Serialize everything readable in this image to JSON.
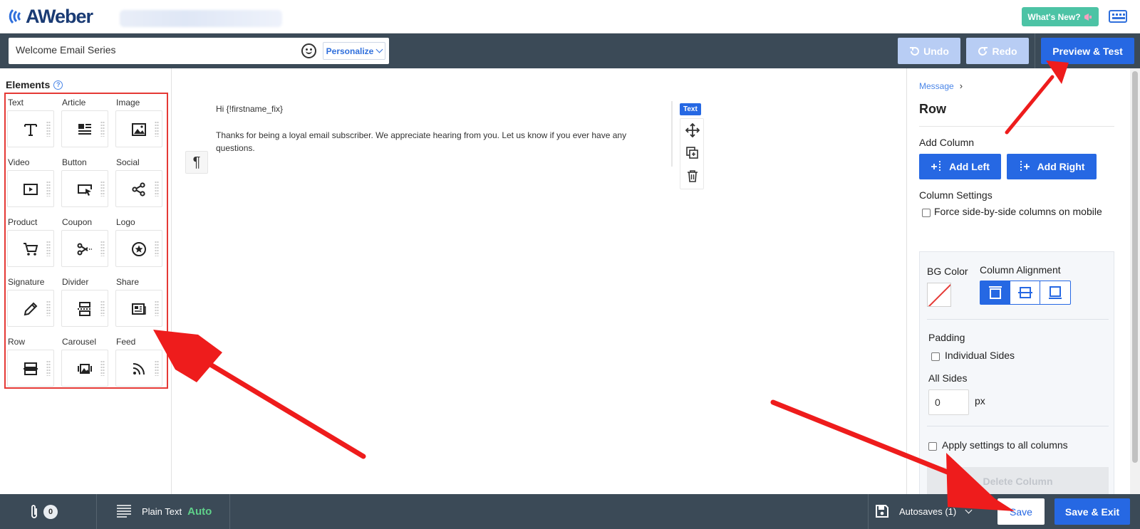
{
  "brand": {
    "name": "AWeber"
  },
  "header": {
    "whats_new_label": "What's New?",
    "whats_new_icon": "megaphone-icon"
  },
  "toolbar": {
    "subject_value": "Welcome Email Series",
    "personalize_label": "Personalize",
    "undo_label": "Undo",
    "redo_label": "Redo",
    "preview_label": "Preview & Test"
  },
  "elements_panel": {
    "title": "Elements",
    "items": [
      {
        "label": "Text",
        "icon": "text-icon"
      },
      {
        "label": "Article",
        "icon": "article-icon"
      },
      {
        "label": "Image",
        "icon": "image-icon"
      },
      {
        "label": "Video",
        "icon": "video-icon"
      },
      {
        "label": "Button",
        "icon": "button-icon"
      },
      {
        "label": "Social",
        "icon": "share-nodes-icon"
      },
      {
        "label": "Product",
        "icon": "cart-icon"
      },
      {
        "label": "Coupon",
        "icon": "scissors-icon"
      },
      {
        "label": "Logo",
        "icon": "star-badge-icon"
      },
      {
        "label": "Signature",
        "icon": "pen-icon"
      },
      {
        "label": "Divider",
        "icon": "divider-icon"
      },
      {
        "label": "Share",
        "icon": "newspaper-icon"
      },
      {
        "label": "Row",
        "icon": "row-icon"
      },
      {
        "label": "Carousel",
        "icon": "carousel-icon"
      },
      {
        "label": "Feed",
        "icon": "rss-icon"
      }
    ]
  },
  "canvas": {
    "greeting": "Hi {!firstname_fix}",
    "body": "Thanks for being a loyal email subscriber. We appreciate hearing from you. Let us know if you ever have any questions.",
    "block_tag": "Text",
    "paragraph_symbol": "¶"
  },
  "properties": {
    "breadcrumb_link": "Message",
    "breadcrumb_sep": "›",
    "title": "Row",
    "add_column_label": "Add Column",
    "add_left_label": "Add Left",
    "add_right_label": "Add Right",
    "column_settings_label": "Column Settings",
    "force_side_label": "Force side-by-side columns on mobile",
    "bg_color_label": "BG Color",
    "column_alignment_label": "Column Alignment",
    "alignment_selected": "top",
    "padding_label": "Padding",
    "individual_sides_label": "Individual Sides",
    "all_sides_label": "All Sides",
    "padding_value": "0",
    "padding_unit": "px",
    "apply_all_label": "Apply settings to all columns",
    "delete_column_label": "Delete Column"
  },
  "statusbar": {
    "attachments_count": "0",
    "plain_text_label": "Plain Text",
    "plain_text_mode": "Auto",
    "autosaves_label": "Autosaves (1)",
    "save_label": "Save",
    "save_exit_label": "Save & Exit"
  },
  "colors": {
    "primary": "#2668e3",
    "toolbar_bg": "#3b4a57",
    "annotation": "#e53935",
    "whats_new": "#4cc3a5"
  }
}
